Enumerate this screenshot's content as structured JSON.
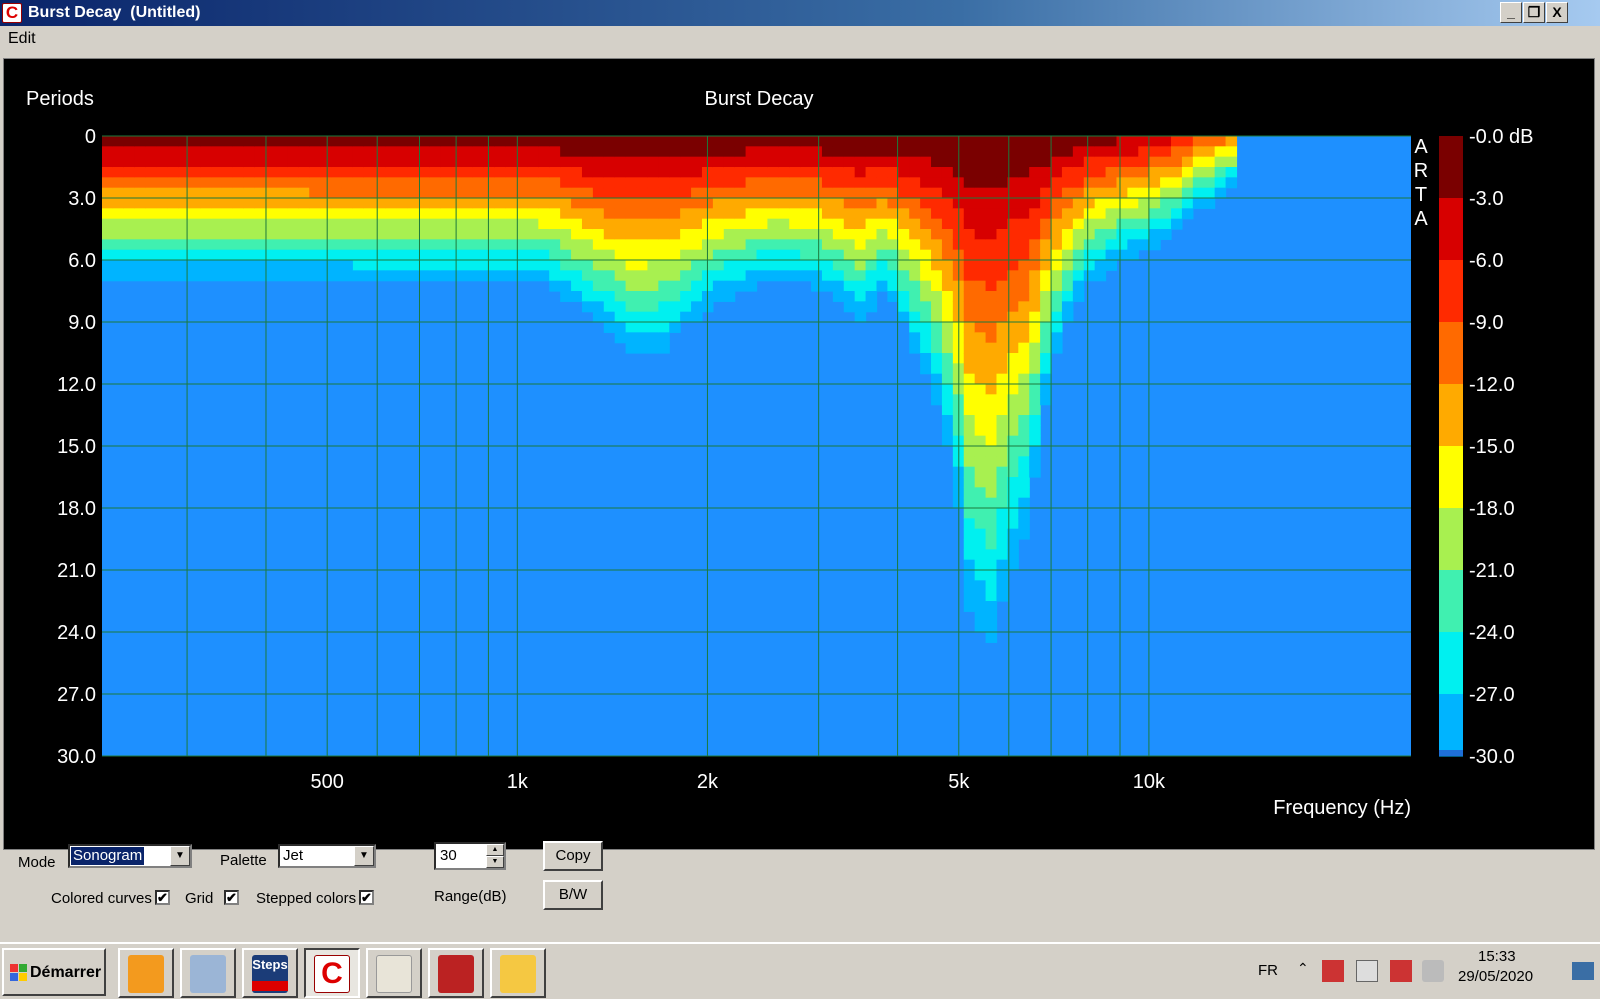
{
  "window": {
    "title": "Burst Decay  (Untitled)",
    "controls": [
      "_",
      "❐",
      "X"
    ]
  },
  "menu": {
    "edit": "Edit"
  },
  "chart_data": {
    "type": "heatmap",
    "title": "Burst Decay",
    "xlabel": "Frequency (Hz)",
    "ylabel": "Periods",
    "x_scale": "log",
    "xlim": [
      220,
      26000
    ],
    "ylim": [
      30,
      0
    ],
    "x_tick_labels": [
      "500",
      "1k",
      "2k",
      "5k",
      "10k"
    ],
    "x_ticks": [
      500,
      1000,
      2000,
      5000,
      10000
    ],
    "y_ticks": [
      0,
      3,
      6,
      9,
      12,
      15,
      18,
      21,
      24,
      27,
      30
    ],
    "y_tick_labels": [
      "0",
      "3.0",
      "6.0",
      "9.0",
      "12.0",
      "15.0",
      "18.0",
      "21.0",
      "24.0",
      "27.0",
      "30.0"
    ],
    "colorbar": {
      "labels": [
        "-0.0 dB",
        "-3.0",
        "-6.0",
        "-9.0",
        "-12.0",
        "-15.0",
        "-18.0",
        "-21.0",
        "-24.0",
        "-27.0",
        "-30.0"
      ],
      "range_db": [
        0,
        -30
      ],
      "palette": "Jet",
      "stepped": true
    },
    "watermark": "ARTA",
    "grid": true,
    "background_color": "#1e90ff",
    "freqs": [
      220,
      400,
      600,
      800,
      950,
      1100,
      1300,
      1500,
      1700,
      2000,
      2500,
      3000,
      3500,
      3800,
      4200,
      4700,
      5200,
      5600,
      6000,
      6500,
      7000,
      8000,
      9000,
      10000,
      11000,
      12000,
      13000,
      13800,
      14200
    ],
    "decay_db_per_period": [
      -4.4,
      -4.4,
      -4.3,
      -4.3,
      -4.3,
      -4.1,
      -3.5,
      -2.7,
      -2.9,
      -3.6,
      -4.3,
      -4.1,
      -3.3,
      -4.0,
      -3.0,
      -2.2,
      -1.3,
      -1.2,
      -1.4,
      -1.6,
      -2.6,
      -4.0,
      -4.6,
      -4.9,
      -5.4,
      -6.0,
      -7.0,
      -7.5,
      -7.5
    ],
    "offset_db": [
      0,
      0,
      0,
      0,
      0,
      -0.5,
      0.5,
      -1,
      0,
      0,
      0,
      0,
      0,
      0,
      0,
      0,
      0,
      0,
      0,
      0,
      0,
      -1,
      -2,
      -3,
      -5,
      -8,
      -10,
      -13,
      -60
    ]
  },
  "controls": {
    "mode_label": "Mode",
    "mode_value": "Sonogram",
    "palette_label": "Palette",
    "palette_value": "Jet",
    "range_value": "30",
    "range_label": "Range(dB)",
    "copy_label": "Copy",
    "bw_label": "B/W",
    "colored_curves_label": "Colored curves",
    "grid_label": "Grid",
    "stepped_colors_label": "Stepped colors",
    "check_mark": "✔"
  },
  "taskbar": {
    "start_label": "Démarrer",
    "steps_label": "Steps",
    "lang": "FR",
    "time": "15:33",
    "date": "29/05/2020"
  }
}
